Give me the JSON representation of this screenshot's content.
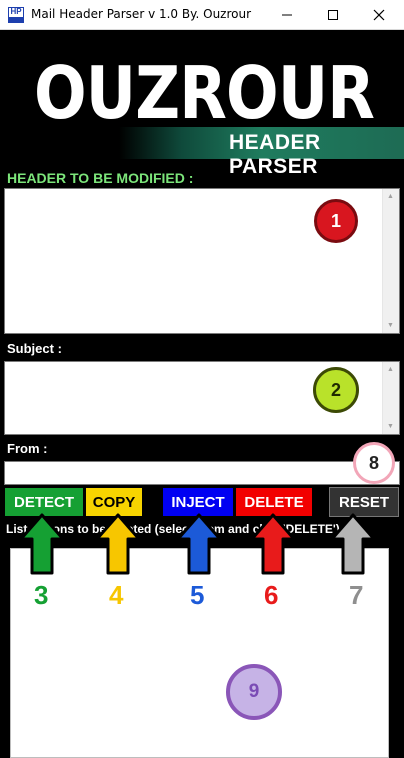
{
  "window": {
    "title": "Mail Header Parser v 1.0 By. Ouzrour",
    "icon_text": "HP"
  },
  "banner": {
    "logo_text": "OUZROUR",
    "subtitle": "HEADER PARSER"
  },
  "labels": {
    "header": "HEADER TO BE MODIFIED :",
    "subject": "Subject :",
    "from": "From :",
    "list": "List options to be deleted (select them and click 'DELETE') :"
  },
  "buttons": {
    "detect": "DETECT",
    "copy": "COPY",
    "inject": "INJECT",
    "delete": "DELETE",
    "reset": "RESET"
  },
  "annotations": {
    "c1": "1",
    "c2": "2",
    "n3": "3",
    "n4": "4",
    "n5": "5",
    "n6": "6",
    "n7": "7",
    "c8": "8",
    "c9": "9"
  },
  "colors": {
    "detect": "#15a033",
    "copy": "#f7d400",
    "inject": "#0000f2",
    "delete": "#f20000",
    "reset": "#333333",
    "header_label": "#7ce57a"
  }
}
